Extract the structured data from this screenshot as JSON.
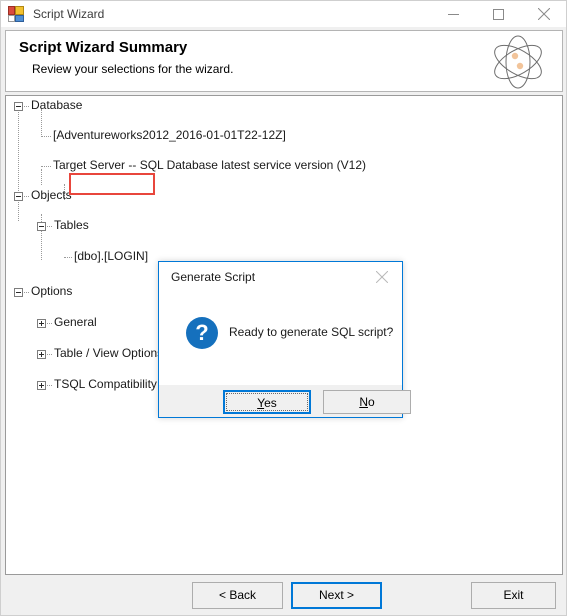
{
  "window": {
    "title": "Script Wizard",
    "icon": "form-designer-icon",
    "controls": {
      "minimize": "minimize-icon",
      "maximize": "maximize-icon",
      "close": "close-icon"
    }
  },
  "header": {
    "title": "Script Wizard Summary",
    "subtitle": "Review your selections for the wizard.",
    "logo": "atom-icon"
  },
  "tree": {
    "nodes": [
      {
        "label": "Database",
        "state": "expanded",
        "depth": 0
      },
      {
        "label": "[Adventureworks2012_2016-01-01T22-12Z]",
        "state": "leaf",
        "depth": 2
      },
      {
        "label": "Target Server -- SQL Database latest service version (V12)",
        "state": "leaf",
        "depth": 2
      },
      {
        "label": "Objects",
        "state": "expanded",
        "depth": 0
      },
      {
        "label": "Tables",
        "state": "expanded",
        "depth": 1
      },
      {
        "label": "[dbo].[LOGIN]",
        "state": "leaf",
        "depth": 2,
        "highlighted": true
      },
      {
        "label": "Options",
        "state": "expanded",
        "depth": 0
      },
      {
        "label": "General",
        "state": "collapsed",
        "depth": 1
      },
      {
        "label": "Table / View Options",
        "state": "collapsed",
        "depth": 1
      },
      {
        "label": "TSQL Compatibility Checks",
        "state": "collapsed",
        "depth": 1
      }
    ],
    "highlight_color": "#e8463c"
  },
  "footer": {
    "back_label": "< Back",
    "next_label": "Next >",
    "exit_label": "Exit",
    "accent_color": "#0078d7"
  },
  "dialog": {
    "title": "Generate Script",
    "close_icon": "close-icon",
    "icon": "question-mark-icon",
    "icon_color": "#1570bd",
    "message": "Ready to generate SQL script?",
    "yes_label": "Yes",
    "yes_accel": "Y",
    "yes_rest": "es",
    "no_label": "No",
    "no_accel": "N",
    "no_rest": "o",
    "focused_button": "Yes"
  }
}
